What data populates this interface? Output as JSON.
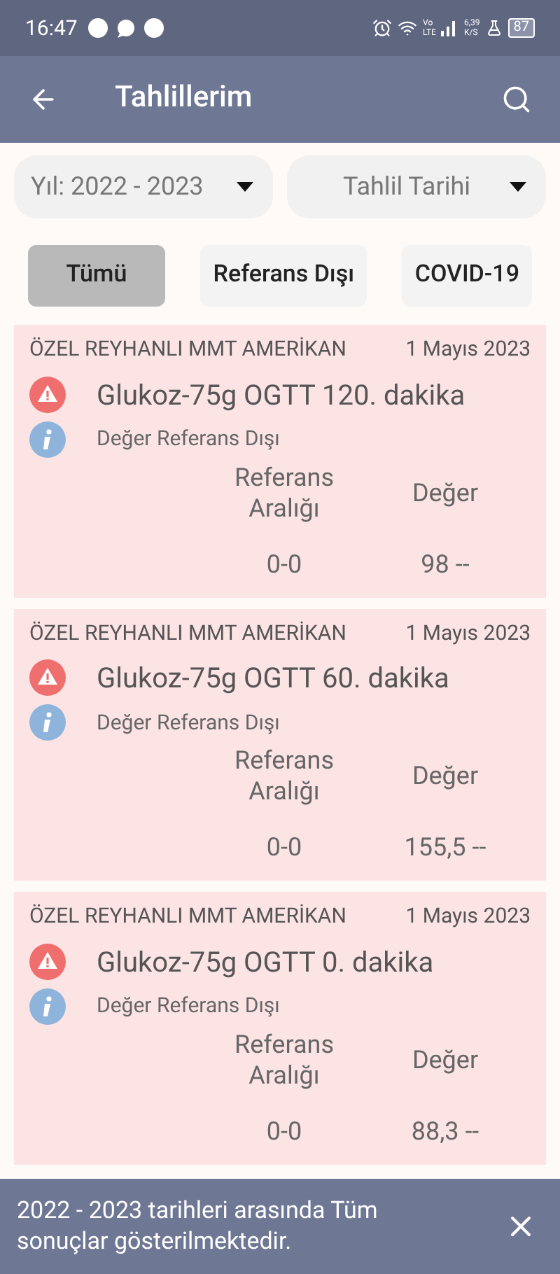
{
  "status_bar": {
    "time": "16:47",
    "volte": "Vo",
    "lte": "LTE",
    "speed": "6,39",
    "speed_unit": "K/S",
    "battery": "87"
  },
  "app_bar": {
    "title": "Tahlillerim"
  },
  "filters": [
    {
      "value": "Yıl: 2022 - 2023"
    },
    {
      "value": "Tahlil Tarihi"
    }
  ],
  "tabs": [
    {
      "label": "Tümü",
      "selected": true
    },
    {
      "label": "Referans Dışı",
      "selected": false
    },
    {
      "label": "COVID-19",
      "selected": false
    }
  ],
  "results": [
    {
      "lab": "ÖZEL REYHANLI MMT AMERİKAN",
      "date": "1 Mayıs 2023",
      "test": "Glukoz-75g OGTT 120. dakika",
      "status": "Değer Referans Dışı",
      "out_of_range": true,
      "range_label": "Referans Aralığı",
      "value_label": "Değer",
      "range": "0-0",
      "value": "98 --"
    },
    {
      "lab": "ÖZEL REYHANLI MMT AMERİKAN",
      "date": "1 Mayıs 2023",
      "test": "Glukoz-75g OGTT 60. dakika",
      "status": "Değer Referans Dışı",
      "out_of_range": true,
      "range_label": "Referans Aralığı",
      "value_label": "Değer",
      "range": "0-0",
      "value": "155,5 --"
    },
    {
      "lab": "ÖZEL REYHANLI MMT AMERİKAN",
      "date": "1 Mayıs 2023",
      "test": "Glukoz-75g OGTT 0. dakika",
      "status": "Değer Referans Dışı",
      "out_of_range": true,
      "range_label": "Referans Aralığı",
      "value_label": "Değer",
      "range": "0-0",
      "value": "88,3 --"
    }
  ],
  "snackbar": {
    "message": "2022 - 2023 tarihleri arasında Tüm sonuçlar gösterilmektedir."
  }
}
